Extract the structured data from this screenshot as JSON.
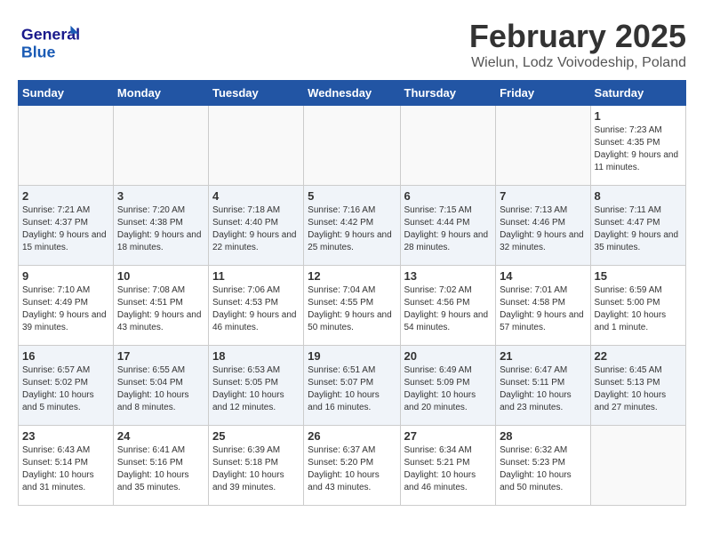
{
  "header": {
    "logo_text_general": "General",
    "logo_text_blue": "Blue",
    "title": "February 2025",
    "subtitle": "Wielun, Lodz Voivodeship, Poland"
  },
  "days_of_week": [
    "Sunday",
    "Monday",
    "Tuesday",
    "Wednesday",
    "Thursday",
    "Friday",
    "Saturday"
  ],
  "weeks": [
    [
      {
        "day": "",
        "info": ""
      },
      {
        "day": "",
        "info": ""
      },
      {
        "day": "",
        "info": ""
      },
      {
        "day": "",
        "info": ""
      },
      {
        "day": "",
        "info": ""
      },
      {
        "day": "",
        "info": ""
      },
      {
        "day": "1",
        "info": "Sunrise: 7:23 AM\nSunset: 4:35 PM\nDaylight: 9 hours and 11 minutes."
      }
    ],
    [
      {
        "day": "2",
        "info": "Sunrise: 7:21 AM\nSunset: 4:37 PM\nDaylight: 9 hours and 15 minutes."
      },
      {
        "day": "3",
        "info": "Sunrise: 7:20 AM\nSunset: 4:38 PM\nDaylight: 9 hours and 18 minutes."
      },
      {
        "day": "4",
        "info": "Sunrise: 7:18 AM\nSunset: 4:40 PM\nDaylight: 9 hours and 22 minutes."
      },
      {
        "day": "5",
        "info": "Sunrise: 7:16 AM\nSunset: 4:42 PM\nDaylight: 9 hours and 25 minutes."
      },
      {
        "day": "6",
        "info": "Sunrise: 7:15 AM\nSunset: 4:44 PM\nDaylight: 9 hours and 28 minutes."
      },
      {
        "day": "7",
        "info": "Sunrise: 7:13 AM\nSunset: 4:46 PM\nDaylight: 9 hours and 32 minutes."
      },
      {
        "day": "8",
        "info": "Sunrise: 7:11 AM\nSunset: 4:47 PM\nDaylight: 9 hours and 35 minutes."
      }
    ],
    [
      {
        "day": "9",
        "info": "Sunrise: 7:10 AM\nSunset: 4:49 PM\nDaylight: 9 hours and 39 minutes."
      },
      {
        "day": "10",
        "info": "Sunrise: 7:08 AM\nSunset: 4:51 PM\nDaylight: 9 hours and 43 minutes."
      },
      {
        "day": "11",
        "info": "Sunrise: 7:06 AM\nSunset: 4:53 PM\nDaylight: 9 hours and 46 minutes."
      },
      {
        "day": "12",
        "info": "Sunrise: 7:04 AM\nSunset: 4:55 PM\nDaylight: 9 hours and 50 minutes."
      },
      {
        "day": "13",
        "info": "Sunrise: 7:02 AM\nSunset: 4:56 PM\nDaylight: 9 hours and 54 minutes."
      },
      {
        "day": "14",
        "info": "Sunrise: 7:01 AM\nSunset: 4:58 PM\nDaylight: 9 hours and 57 minutes."
      },
      {
        "day": "15",
        "info": "Sunrise: 6:59 AM\nSunset: 5:00 PM\nDaylight: 10 hours and 1 minute."
      }
    ],
    [
      {
        "day": "16",
        "info": "Sunrise: 6:57 AM\nSunset: 5:02 PM\nDaylight: 10 hours and 5 minutes."
      },
      {
        "day": "17",
        "info": "Sunrise: 6:55 AM\nSunset: 5:04 PM\nDaylight: 10 hours and 8 minutes."
      },
      {
        "day": "18",
        "info": "Sunrise: 6:53 AM\nSunset: 5:05 PM\nDaylight: 10 hours and 12 minutes."
      },
      {
        "day": "19",
        "info": "Sunrise: 6:51 AM\nSunset: 5:07 PM\nDaylight: 10 hours and 16 minutes."
      },
      {
        "day": "20",
        "info": "Sunrise: 6:49 AM\nSunset: 5:09 PM\nDaylight: 10 hours and 20 minutes."
      },
      {
        "day": "21",
        "info": "Sunrise: 6:47 AM\nSunset: 5:11 PM\nDaylight: 10 hours and 23 minutes."
      },
      {
        "day": "22",
        "info": "Sunrise: 6:45 AM\nSunset: 5:13 PM\nDaylight: 10 hours and 27 minutes."
      }
    ],
    [
      {
        "day": "23",
        "info": "Sunrise: 6:43 AM\nSunset: 5:14 PM\nDaylight: 10 hours and 31 minutes."
      },
      {
        "day": "24",
        "info": "Sunrise: 6:41 AM\nSunset: 5:16 PM\nDaylight: 10 hours and 35 minutes."
      },
      {
        "day": "25",
        "info": "Sunrise: 6:39 AM\nSunset: 5:18 PM\nDaylight: 10 hours and 39 minutes."
      },
      {
        "day": "26",
        "info": "Sunrise: 6:37 AM\nSunset: 5:20 PM\nDaylight: 10 hours and 43 minutes."
      },
      {
        "day": "27",
        "info": "Sunrise: 6:34 AM\nSunset: 5:21 PM\nDaylight: 10 hours and 46 minutes."
      },
      {
        "day": "28",
        "info": "Sunrise: 6:32 AM\nSunset: 5:23 PM\nDaylight: 10 hours and 50 minutes."
      },
      {
        "day": "",
        "info": ""
      }
    ]
  ]
}
